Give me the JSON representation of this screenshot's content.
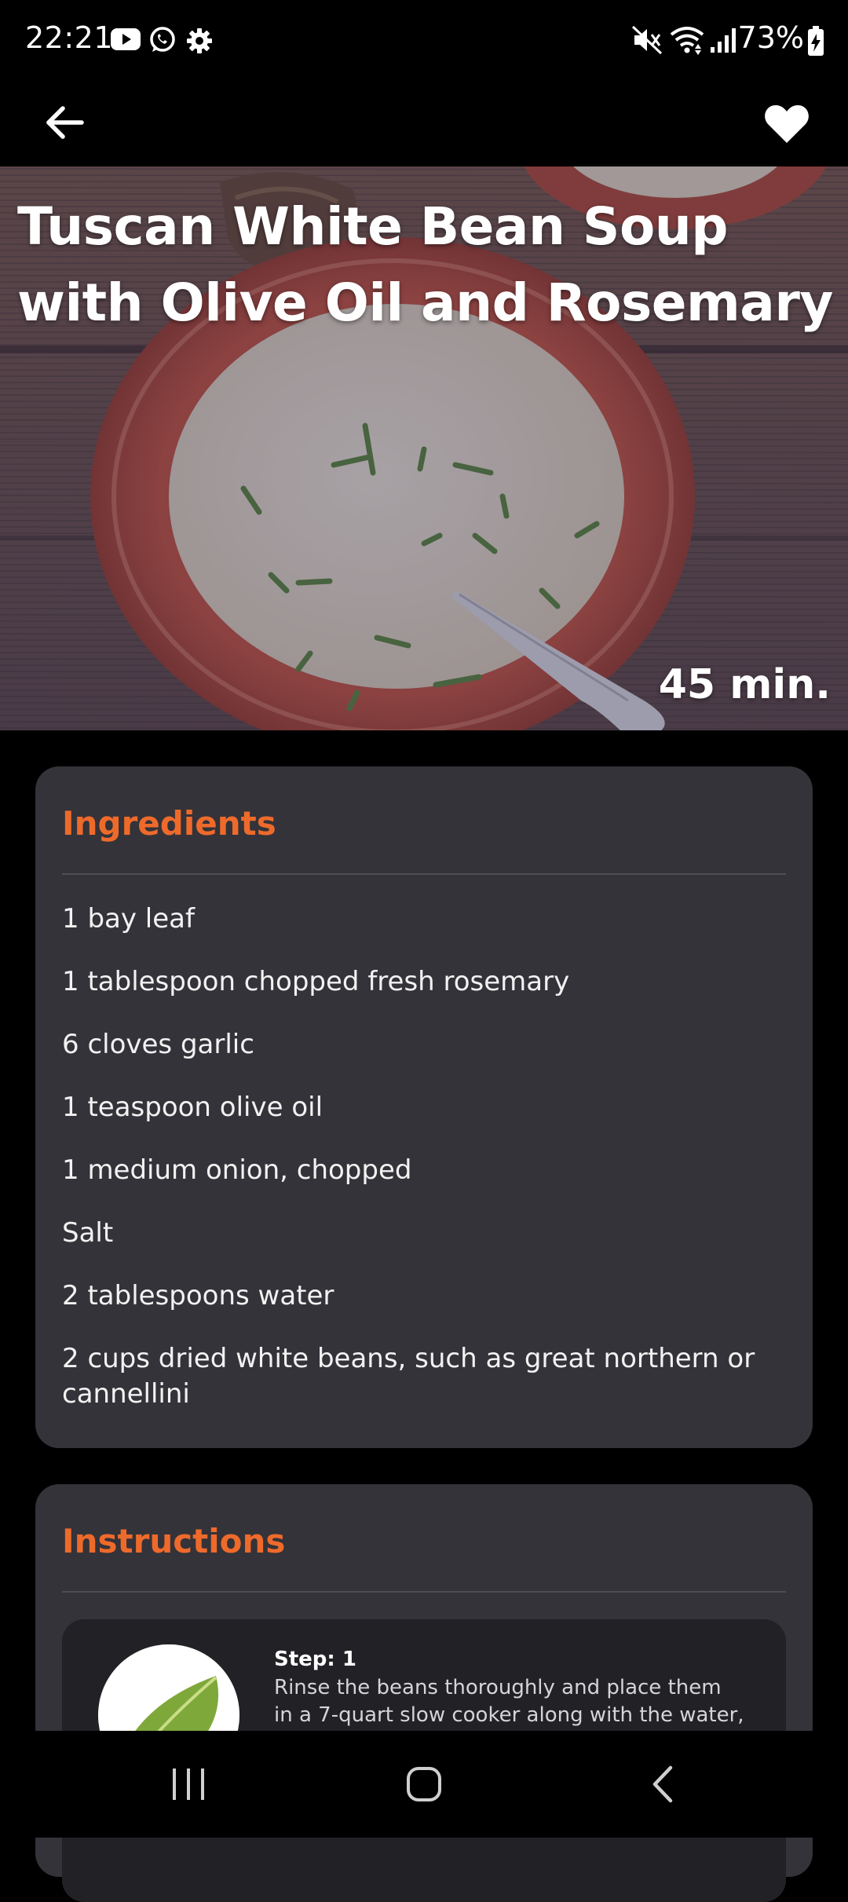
{
  "status_bar": {
    "time": "22:21",
    "battery_percent": "73%",
    "left_icons": [
      "youtube-icon",
      "whatsapp-icon",
      "settings-gear-icon"
    ],
    "right_icons": [
      "mute-icon",
      "wifi-icon",
      "signal-icon",
      "battery-charging-icon"
    ]
  },
  "app_bar": {
    "back_icon": "arrow-left-icon",
    "favorite_icon": "heart-icon"
  },
  "recipe": {
    "title": "Tuscan White Bean Soup with Olive Oil and Rosemary",
    "time": "45 min."
  },
  "ingredients": {
    "title": "Ingredients",
    "items": [
      "1 bay leaf",
      "1 tablespoon chopped fresh rosemary",
      "6 cloves garlic",
      "1 teaspoon olive oil",
      "1 medium onion, chopped",
      "Salt",
      "2 tablespoons water",
      "2 cups dried white beans, such as great northern or cannellini"
    ]
  },
  "instructions": {
    "title": "Instructions",
    "steps": [
      {
        "label": "Step: 1",
        "text": "Rinse the beans thoroughly and place them in a 7-quart slow cooker along with the water, onion,"
      }
    ]
  },
  "nav_bar": {
    "icons": [
      "recent-apps-icon",
      "home-icon",
      "back-nav-icon"
    ]
  },
  "colors": {
    "accent": "#ee6a2b",
    "card_bg": "#343339",
    "step_bg": "#222226",
    "page_bg": "#000000"
  }
}
